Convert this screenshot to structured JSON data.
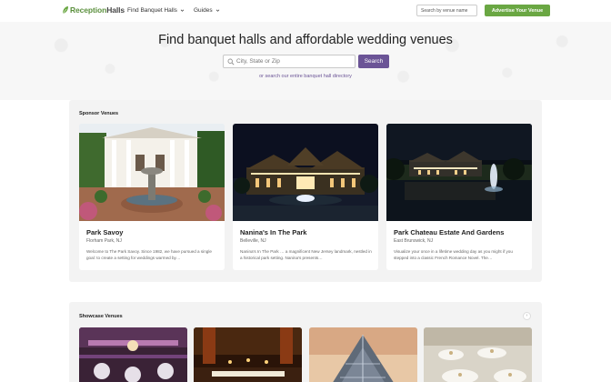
{
  "header": {
    "logo_text_green": "Reception",
    "logo_text_dark": "Halls",
    "nav_find": "Find Banquet Halls",
    "nav_guides": "Guides",
    "search_placeholder": "Search by venue name",
    "advertise_label": "Advertise Your Venue"
  },
  "hero": {
    "title": "Find banquet halls and affordable wedding venues",
    "search_placeholder": "City, State or Zip",
    "search_button": "Search",
    "directory_link": "or search our entire banquet hall directory"
  },
  "sponsor": {
    "title": "Sponsor Venues",
    "cards": [
      {
        "name": "Park Savoy",
        "location": "Florham Park, NJ",
        "description": "Welcome to The Park Savoy. Since 1982, we have pursued a single goal: to create a setting for weddings warmed by…"
      },
      {
        "name": "Nanina's In The Park",
        "location": "Belleville, NJ",
        "description": "Nanina's In The Park … a magnificent New Jersey landmark, nestled in a historical park setting. Nanina's presents…"
      },
      {
        "name": "Park Chateau Estate And Gardens",
        "location": "East Brunswick, NJ",
        "description": "Visualize your once in a lifetime wedding day as you might if you stepped into a classic French Romance Novel. The…"
      }
    ]
  },
  "showcase": {
    "title": "Showcase Venues",
    "next_label": "›"
  },
  "colors": {
    "brand_green": "#6aa743",
    "brand_purple": "#6b5496"
  }
}
